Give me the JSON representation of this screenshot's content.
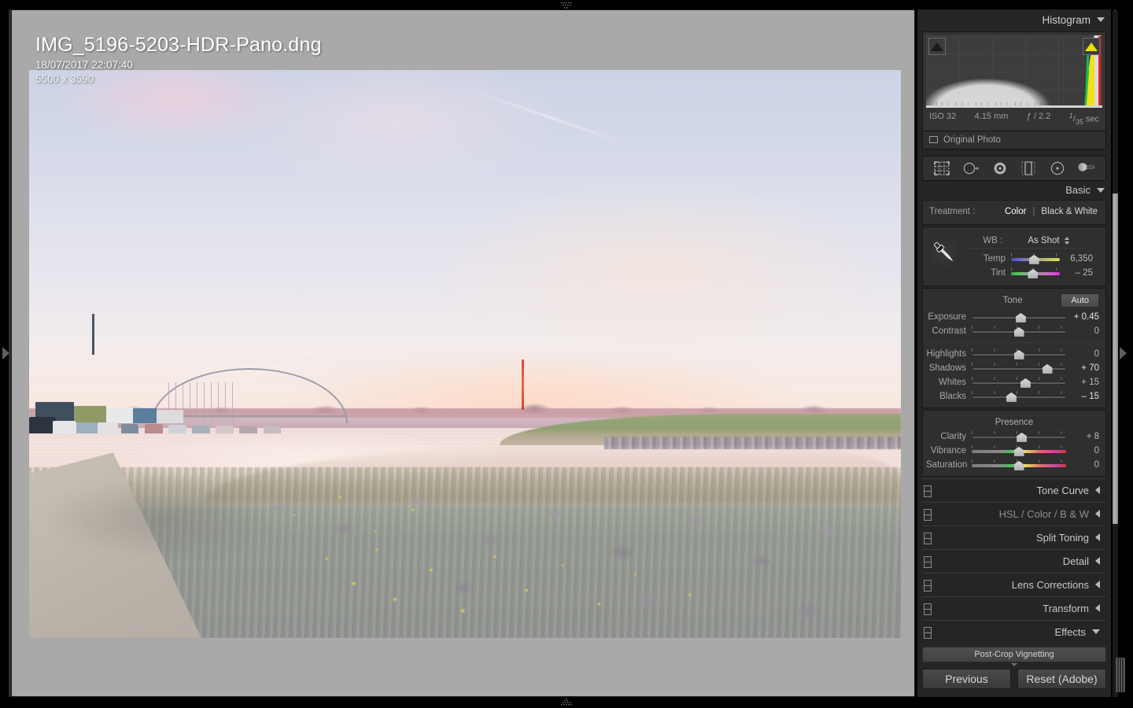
{
  "photo": {
    "filename": "IMG_5196-5203-HDR-Pano.dng",
    "datetime": "18/07/2017 22:07:40",
    "dimensions": "5500 x 3590"
  },
  "histogram": {
    "title": "Histogram",
    "collapse_icon": "chevron-down-icon",
    "shadow_clipping_icon": "triangle-up-icon",
    "highlight_clipping_icon": "triangle-up-icon",
    "highlight_clipping_color": "#e8e000",
    "exif": {
      "iso": "ISO 32",
      "focal_length": "4.15 mm",
      "aperture": "ƒ / 2.2",
      "shutter_numerator": "1",
      "shutter_denominator": "35",
      "shutter_unit": "sec"
    },
    "original_photo_label": "Original Photo"
  },
  "toolstrip": {
    "tools": [
      {
        "name": "crop-overlay-tool",
        "label": "Crop Overlay"
      },
      {
        "name": "spot-removal-tool",
        "label": "Spot Removal"
      },
      {
        "name": "red-eye-correction-tool",
        "label": "Red Eye Correction"
      },
      {
        "name": "graduated-filter-tool",
        "label": "Graduated Filter"
      },
      {
        "name": "radial-filter-tool",
        "label": "Radial Filter"
      },
      {
        "name": "adjustment-brush-tool",
        "label": "Adjustment Brush"
      }
    ]
  },
  "basic": {
    "title": "Basic",
    "collapse_icon": "chevron-down-icon",
    "treatment": {
      "label": "Treatment :",
      "color_option": "Color",
      "separator": "|",
      "bw_option": "Black & White",
      "selected": "Color"
    },
    "wb": {
      "label": "WB :",
      "value": "As Shot",
      "eyedropper_icon": "eyedropper-icon"
    },
    "wb_sliders": [
      {
        "name": "temp",
        "label": "Temp",
        "value": "6,350",
        "pos": 47,
        "track": "temp"
      },
      {
        "name": "tint",
        "label": "Tint",
        "value": "– 25",
        "pos": 45,
        "track": "tint"
      }
    ],
    "tone": {
      "label": "Tone",
      "auto_label": "Auto"
    },
    "tone_sliders_top": [
      {
        "name": "exposure",
        "label": "Exposure",
        "value": "+ 0.45",
        "pos": 52,
        "bold": true
      },
      {
        "name": "contrast",
        "label": "Contrast",
        "value": "0",
        "pos": 50,
        "bold": false
      }
    ],
    "tone_sliders_bottom": [
      {
        "name": "highlights",
        "label": "Highlights",
        "value": "0",
        "pos": 50,
        "bold": false
      },
      {
        "name": "shadows",
        "label": "Shadows",
        "value": "+ 70",
        "pos": 80,
        "bold": true
      },
      {
        "name": "whites",
        "label": "Whites",
        "value": "+ 15",
        "pos": 57,
        "bold": false
      },
      {
        "name": "blacks",
        "label": "Blacks",
        "value": "– 15",
        "pos": 42,
        "bold": true
      }
    ],
    "presence": {
      "label": "Presence"
    },
    "presence_sliders": [
      {
        "name": "clarity",
        "label": "Clarity",
        "value": "+ 8",
        "pos": 53,
        "track": ""
      },
      {
        "name": "vibrance",
        "label": "Vibrance",
        "value": "0",
        "pos": 50,
        "track": "vib"
      },
      {
        "name": "saturation",
        "label": "Saturation",
        "value": "0",
        "pos": 50,
        "track": "sat"
      }
    ]
  },
  "panels": [
    {
      "name": "tone-curve",
      "label": "Tone Curve",
      "icon": "chevron-left-icon",
      "dim": false
    },
    {
      "name": "hsl-color-bw",
      "label": "HSL / Color / B & W",
      "icon": "chevron-left-icon",
      "dim": true
    },
    {
      "name": "split-toning",
      "label": "Split Toning",
      "icon": "chevron-left-icon",
      "dim": false
    },
    {
      "name": "detail",
      "label": "Detail",
      "icon": "chevron-left-icon",
      "dim": false
    },
    {
      "name": "lens-corrections",
      "label": "Lens Corrections",
      "icon": "chevron-left-icon",
      "dim": false
    },
    {
      "name": "transform",
      "label": "Transform",
      "icon": "chevron-left-icon",
      "dim": false
    },
    {
      "name": "effects",
      "label": "Effects",
      "icon": "chevron-down-icon",
      "dim": false
    }
  ],
  "effects": {
    "post_crop_vignetting_label": "Post-Crop Vignetting"
  },
  "footer": {
    "previous_label": "Previous",
    "reset_label": "Reset (Adobe)"
  },
  "colors": {
    "panel_bg": "#252525",
    "workspace_bg": "#a9a9a9",
    "accent_clip": "#e8e000",
    "text": "#b4b4b4"
  }
}
